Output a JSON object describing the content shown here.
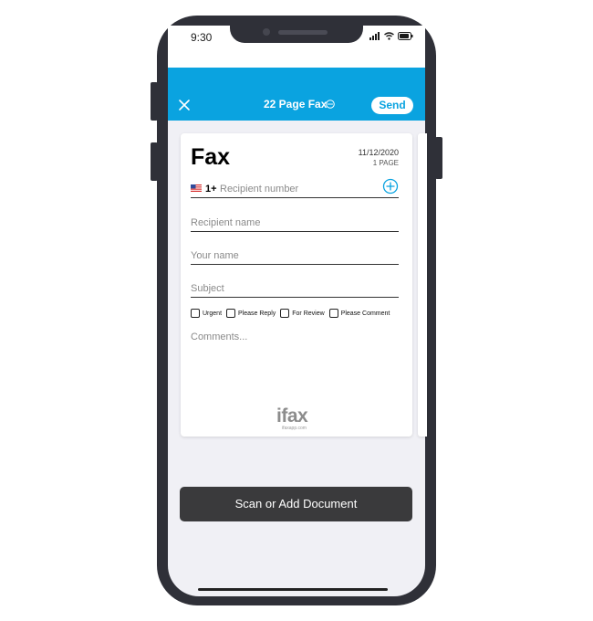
{
  "status_bar": {
    "time": "9:30"
  },
  "header": {
    "title": "22 Page Fax",
    "send_label": "Send"
  },
  "fax_card": {
    "heading": "Fax",
    "date": "11/12/2020",
    "page_count": "1 PAGE",
    "country_code": "1+",
    "recipient_number_placeholder": "Recipient number",
    "recipient_name_placeholder": "Recipient name",
    "your_name_placeholder": "Your name",
    "subject_placeholder": "Subject",
    "checkboxes": [
      "Urgent",
      "Please Reply",
      "For Review",
      "Please Comment"
    ],
    "comments_placeholder": "Comments...",
    "logo": "ifax",
    "logo_url": "ifaxapp.com"
  },
  "scan_button": {
    "label": "Scan or Add Document"
  },
  "colors": {
    "accent": "#0aa3e0",
    "button_dark": "#3a3a3c",
    "phone_frame": "#2f3038"
  }
}
